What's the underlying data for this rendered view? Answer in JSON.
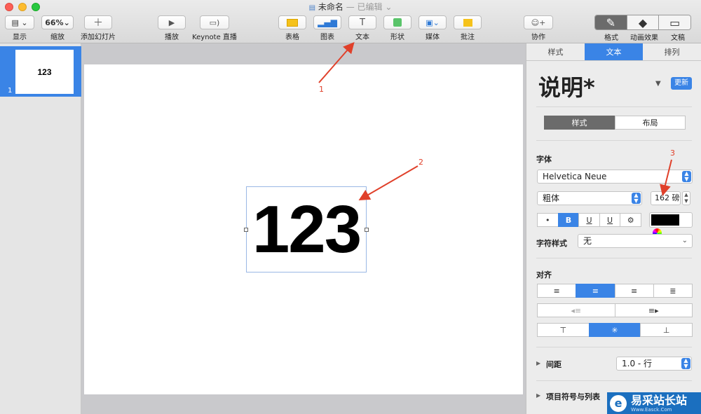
{
  "window": {
    "title": "未命名",
    "status": "— 已编辑 ⌄"
  },
  "toolbar": {
    "view": "显示",
    "zoom_value": "66%",
    "zoom": "缩放",
    "add_slide": "添加幻灯片",
    "play": "播放",
    "live": "Keynote 直播",
    "table": "表格",
    "chart": "图表",
    "text": "文本",
    "shape": "形状",
    "media": "媒体",
    "comment": "批注",
    "collab": "协作",
    "format": "格式",
    "animate": "动画效果",
    "document": "文稿"
  },
  "slides": [
    {
      "number": "1",
      "text": "123"
    }
  ],
  "slide": {
    "text": "123"
  },
  "inspector": {
    "tabs": [
      "样式",
      "文本",
      "排列"
    ],
    "style_name": "说明*",
    "update": "更新",
    "subtabs": [
      "样式",
      "布局"
    ],
    "font_label": "字体",
    "font_family": "Helvetica Neue",
    "font_weight": "粗体",
    "font_size": "162 磅",
    "char_style_label": "字符样式",
    "char_style_value": "无",
    "align_label": "对齐",
    "spacing_label": "间距",
    "spacing_value": "1.0 - 行",
    "bullets_label": "项目符号与列表",
    "format_buttons": [
      "•",
      "B",
      "U",
      "U",
      "⚙"
    ]
  },
  "annotations": [
    "1",
    "2",
    "3"
  ],
  "watermark": {
    "text": "易采站长站",
    "sub": "Www.Easck.Com"
  },
  "colors": {
    "accent": "#3a84e6",
    "arrow": "#e0402a"
  }
}
